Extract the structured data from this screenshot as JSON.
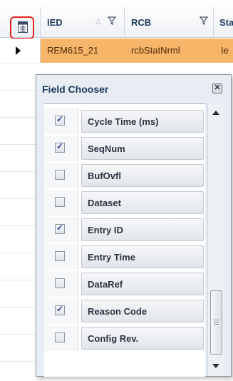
{
  "grid": {
    "columns": [
      {
        "label": "IED"
      },
      {
        "label": "RCB"
      },
      {
        "label": "Sta"
      }
    ],
    "selected_row": {
      "ied": "REM615_21",
      "rcb": "rcbStatNrml",
      "third": "Ie"
    },
    "selected_row_color": "#f7b56a",
    "highlight_color": "#e2231a"
  },
  "field_chooser": {
    "title": "Field Chooser",
    "close_glyph": "✕",
    "items": [
      {
        "label": "Cycle Time (ms)",
        "checked": true
      },
      {
        "label": "SeqNum",
        "checked": true
      },
      {
        "label": "BufOvfl",
        "checked": false
      },
      {
        "label": "Dataset",
        "checked": false
      },
      {
        "label": "Entry ID",
        "checked": true
      },
      {
        "label": "Entry Time",
        "checked": false
      },
      {
        "label": "DataRef",
        "checked": false
      },
      {
        "label": "Reason Code",
        "checked": true
      },
      {
        "label": "Config Rev.",
        "checked": false
      }
    ],
    "tick_glyph": "✓"
  },
  "icons": {
    "chooser": "field-chooser-icon",
    "sort": "sort-asc-icon",
    "filter": "filter-icon",
    "row_indicator": "current-row-arrow-icon",
    "close": "close-icon",
    "scroll_up": "scroll-up-icon",
    "scroll_down": "scroll-down-icon"
  }
}
